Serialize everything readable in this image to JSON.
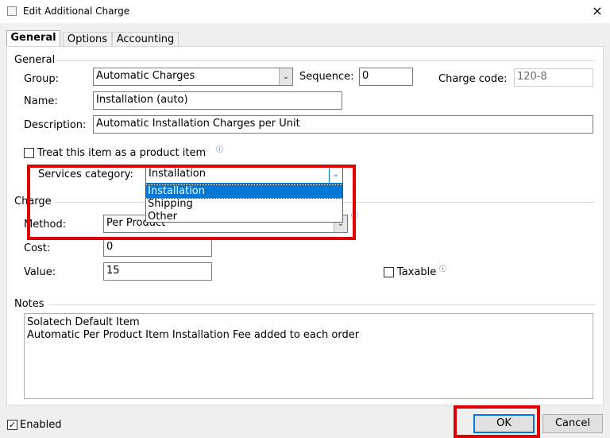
{
  "window": {
    "title": "Edit Additional Charge",
    "close_icon": "×"
  },
  "tabs": [
    {
      "label": "General"
    },
    {
      "label": "Options"
    },
    {
      "label": "Accounting"
    }
  ],
  "general": {
    "legend": "General",
    "group_label": "Group:",
    "group_value": "Automatic Charges",
    "sequence_label": "Sequence:",
    "sequence_value": "0",
    "charge_code_label": "Charge code:",
    "charge_code_value": "120-8",
    "name_label": "Name:",
    "name_value": "Installation (auto)",
    "description_label": "Description:",
    "description_value": "Automatic Installation Charges per Unit",
    "product_item_label": "Treat this item as a product item",
    "product_item_checked": false,
    "services_category_label": "Services category:",
    "services_category_value": "Installation",
    "services_category_options": [
      "Installation",
      "Shipping",
      "Other"
    ]
  },
  "charge": {
    "legend": "Charge",
    "method_label": "Method:",
    "method_value": "Per Product",
    "cost_label": "Cost:",
    "cost_value": "0",
    "value_label": "Value:",
    "value_value": "15",
    "taxable_label": "Taxable",
    "taxable_checked": false
  },
  "notes": {
    "legend": "Notes",
    "line1": "Solatech Default Item",
    "line2": "Automatic Per Product Item Installation Fee added to each order"
  },
  "footer": {
    "enabled_label": "Enabled",
    "enabled_checked": true,
    "ok_label": "OK",
    "cancel_label": "Cancel"
  },
  "icons": {
    "info": "ⓘ",
    "dropdown": "⌄",
    "check": "✓"
  },
  "colors": {
    "highlight": "#e00000",
    "selection": "#0078d7"
  }
}
